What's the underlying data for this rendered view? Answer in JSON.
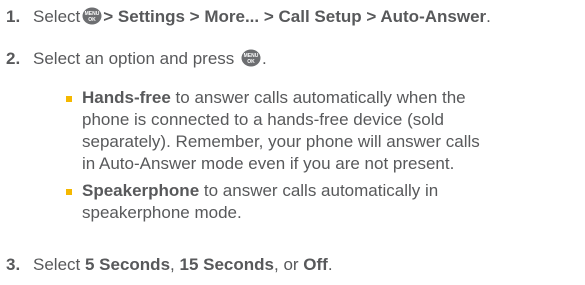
{
  "steps": [
    {
      "number": "1.",
      "prefix": "Select",
      "menu_icon": "menu-ok-key-icon",
      "path": "> Settings > More... > Call Setup > Auto-Answer",
      "suffix": "."
    },
    {
      "number": "2.",
      "prefix": "Select an option and press",
      "menu_icon": "menu-ok-key-icon",
      "suffix": ".",
      "bullets": [
        {
          "bold": "Hands-free",
          "lines": [
            "to answer calls automatically when the",
            "phone is connected to a hands-free device (sold",
            "separately). Remember, your phone will answer calls",
            "in Auto-Answer mode even if you are not present."
          ]
        },
        {
          "bold": "Speakerphone",
          "lines": [
            "to answer calls automatically in",
            "speakerphone mode."
          ]
        }
      ]
    },
    {
      "number": "3.",
      "prefix": "Select",
      "opt1": "5 Seconds",
      "sep1": ",",
      "opt2": "15 Seconds",
      "sep2": ", or",
      "opt3": "Off",
      "suffix": "."
    }
  ],
  "colors": {
    "text": "#58595b",
    "bullet": "#f5b800",
    "key": "#6d6e71"
  }
}
